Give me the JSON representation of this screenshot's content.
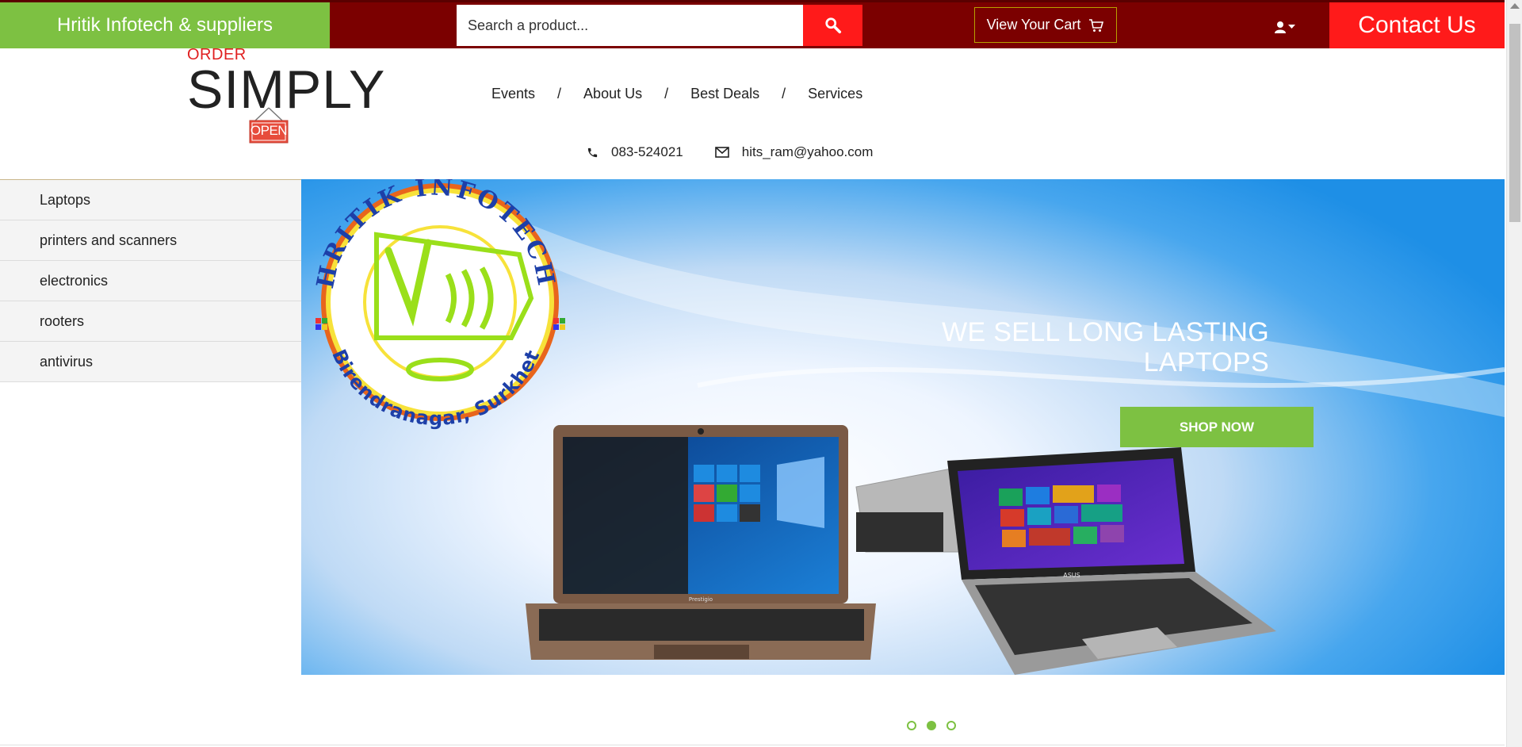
{
  "topbar": {
    "brand": "Hritik Infotech & suppliers",
    "search_placeholder": "Search a product...",
    "cart_label": "View Your Cart",
    "contact_label": "Contact Us"
  },
  "logo": {
    "order": "ORDER",
    "simply": "SIMPLY",
    "sign": "OPEN"
  },
  "nav": {
    "items": [
      "Events",
      "About Us",
      "Best Deals",
      "Services"
    ],
    "separator": "/"
  },
  "contact": {
    "phone": "083-524021",
    "email": "hits_ram@yahoo.com"
  },
  "sidebar": {
    "categories": [
      "Laptops",
      "printers and scanners",
      "electronics",
      "rooters",
      "antivirus"
    ]
  },
  "hero": {
    "headline_line1": "WE SELL LONG LASTING",
    "headline_line2": "LAPTOPS",
    "cta": "SHOP NOW",
    "badge_top": "HRITIK INFOTECH",
    "badge_bottom": "Birendranagar, Surkhet",
    "laptop1_brand": "Prestigio",
    "laptop2_brand": "ASUS"
  },
  "carousel": {
    "slides": 3,
    "active_index": 1
  },
  "colors": {
    "accent_green": "#7dc142",
    "dark_red": "#7b0000",
    "bright_red": "#ff1a1a"
  },
  "icons": {
    "search": "search-icon",
    "cart": "cart-icon",
    "user": "user-icon",
    "phone": "phone-icon",
    "email": "envelope-icon"
  }
}
